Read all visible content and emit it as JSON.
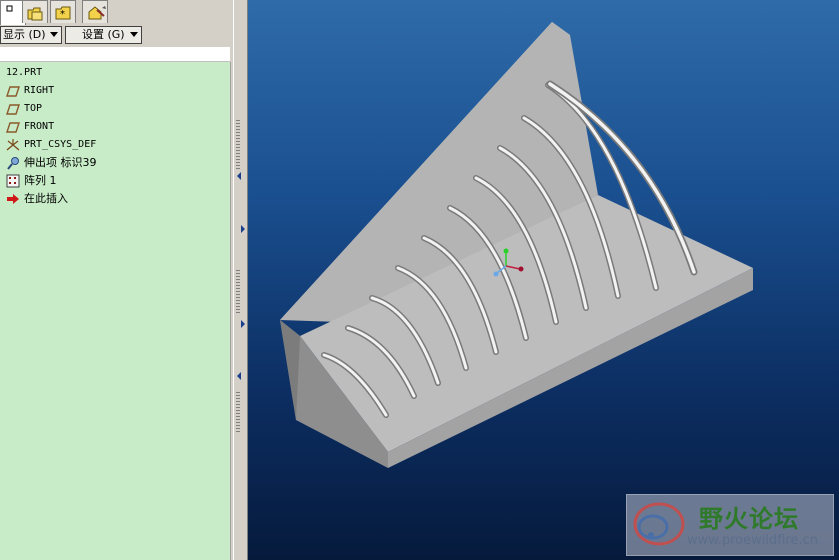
{
  "tabs": [
    {
      "icon": "model-tree-tab-icon",
      "active": true
    },
    {
      "icon": "folder-browser-icon",
      "active": false
    },
    {
      "icon": "favorites-folder-icon",
      "active": false
    },
    {
      "icon": "connections-tools-icon",
      "active": false
    }
  ],
  "menubar": {
    "show_label": "显示 (D)",
    "settings_label": "设置 (G)"
  },
  "tree": {
    "root": "12.PRT",
    "items": [
      {
        "label": "RIGHT",
        "icon": "datum-plane-icon"
      },
      {
        "label": "TOP",
        "icon": "datum-plane-icon"
      },
      {
        "label": "FRONT",
        "icon": "datum-plane-icon"
      },
      {
        "label": "PRT_CSYS_DEF",
        "icon": "coordinate-system-icon"
      },
      {
        "label": "伸出项 标识39",
        "icon": "protrusion-feature-icon"
      },
      {
        "label": "阵列 1",
        "icon": "pattern-icon"
      },
      {
        "label": "在此插入",
        "icon": "insert-here-arrow-icon"
      }
    ]
  },
  "watermark": {
    "title": "野火论坛",
    "url": "www.proewildfire.cn"
  },
  "colors": {
    "tree_background": "#c8ecc8",
    "viewport_top": "#2f6ba9",
    "viewport_bottom": "#061a3c",
    "model_gray": "#b9b9b9",
    "watermark_green": "#2f7a2a"
  }
}
